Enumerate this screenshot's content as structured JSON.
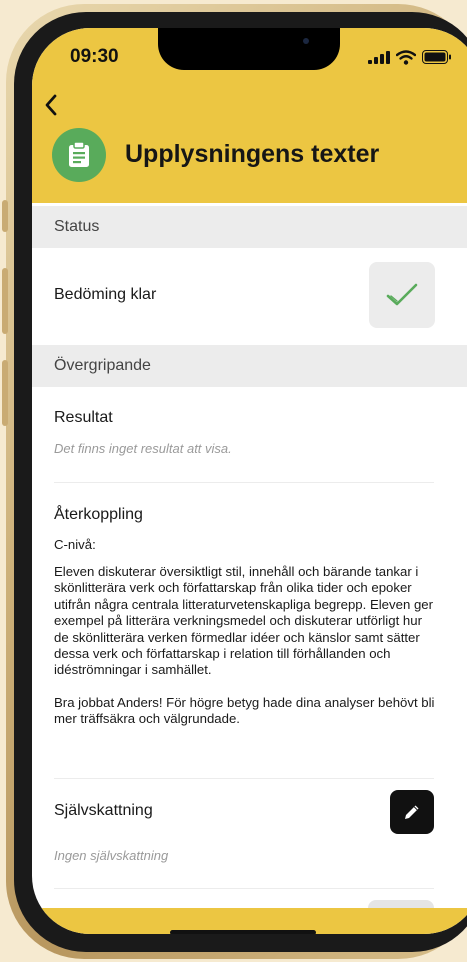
{
  "status_bar": {
    "time": "09:30"
  },
  "header": {
    "title": "Upplysningens texter"
  },
  "sections": {
    "status": {
      "heading": "Status",
      "assessment_label": "Bedöming klar"
    },
    "overall": {
      "heading": "Övergripande",
      "result_label": "Resultat",
      "result_empty": "Det finns inget resultat att visa.",
      "feedback_label": "Återkoppling",
      "feedback_level": "C-nivå:",
      "feedback_paragraph_1": "Eleven diskuterar översiktligt stil, innehåll och bärande tankar i skönlitterära verk och författarskap från olika tider och epoker utifrån några centrala litteraturvetenskapliga begrepp. Eleven ger exempel på litterära verkningsmedel och diskuterar utförligt hur de skönlitterära verken förmedlar idéer och känslor samt sätter dessa verk och författarskap i relation till förhållanden och idéströmningar i samhället.",
      "feedback_paragraph_2": "Bra jobbat Anders! För högre betyg hade dina analyser behövt bli mer träffsäkra och välgrundade.",
      "self_assessment_label": "Självskattning",
      "self_assessment_empty": "Ingen självskattning"
    }
  },
  "colors": {
    "header_yellow": "#ecc642",
    "icon_green": "#59ab5b",
    "check_green": "#59ab5b"
  },
  "icons": {
    "back": "chevron-left-icon",
    "app": "clipboard-icon",
    "check": "checkmark-icon",
    "edit": "pencil-icon"
  }
}
